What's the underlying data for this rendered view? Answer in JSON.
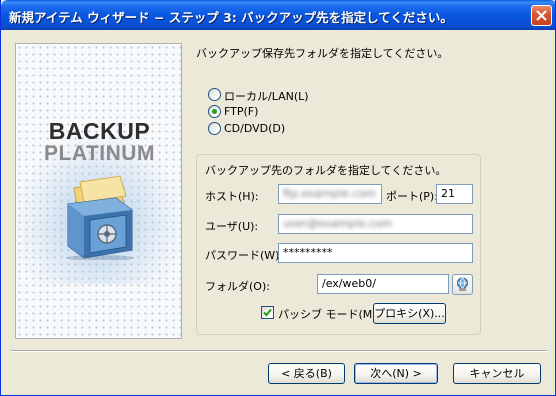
{
  "window": {
    "title": "新規アイテム ウィザード − ステップ 3: バックアップ先を指定してください。"
  },
  "branding": {
    "logo_line1": "BACKUP",
    "logo_line2": "PLATINUM"
  },
  "main": {
    "heading": "バックアップ保存先フォルダを指定してください。",
    "destination_options": [
      {
        "label": "ローカル/LAN(L)",
        "selected": false
      },
      {
        "label": "FTP(F)",
        "selected": true
      },
      {
        "label": "CD/DVD(D)",
        "selected": false
      }
    ]
  },
  "ftp_group": {
    "caption": "バックアップ先のフォルダを指定してください。",
    "host_label": "ホスト(H):",
    "host_value": "ftp.example.com",
    "port_label": "ポート(P):",
    "port_value": "21",
    "user_label": "ユーザ(U):",
    "user_value": "user@example.com",
    "password_label": "パスワード(W):",
    "password_value": "*********",
    "folder_label": "フォルダ(O):",
    "folder_value": "/ex/web0/",
    "passive_label": "パッシブ モード(M)",
    "passive_checked": true,
    "proxy_button": "プロキシ(X)..."
  },
  "footer": {
    "back_button": "< 戻る(B)",
    "next_button": "次へ(N) >",
    "cancel_button": "キャンセル"
  },
  "colors": {
    "title_bar": "#0a5ee8",
    "dialog_background": "#ece9d8",
    "radio_selected": "#21a121",
    "checkmark": "#21a121"
  },
  "icons": {
    "close": "close-icon",
    "browse_folder": "folder-browse-icon",
    "safe_artwork": "safe-illustration"
  }
}
